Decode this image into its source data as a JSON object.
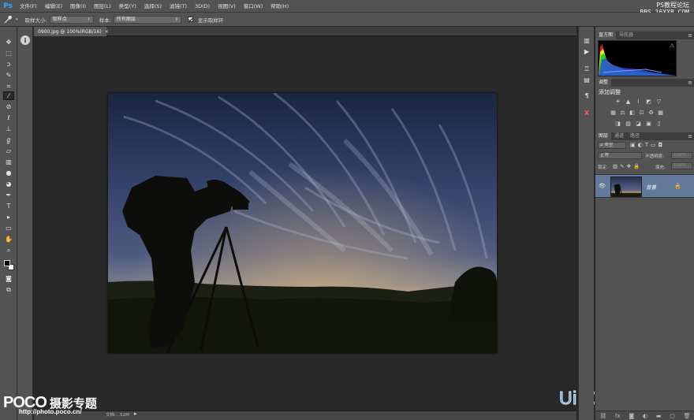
{
  "menubar": {
    "logo": "Ps",
    "items": [
      "文件(F)",
      "编辑(E)",
      "图像(I)",
      "图层(L)",
      "类型(Y)",
      "选择(S)",
      "滤镜(T)",
      "3D(D)",
      "视图(V)",
      "窗口(W)",
      "帮助(H)"
    ]
  },
  "watermark_top": {
    "line1": "PS教程论坛",
    "line2": "BBS.16XX8.COM"
  },
  "options": {
    "tool_icon": "eyedropper-icon",
    "sample_size_label": "取样大小:",
    "sample_size_value": "取样点",
    "sample_label": "样本:",
    "sample_value": "所有图层",
    "show_ring_label": "显示取样环",
    "show_ring_checked": true
  },
  "document": {
    "tab_title": "0900.jpg @ 100%(RGB/16)",
    "close": "×"
  },
  "status": {
    "size_text": "文档:...52M",
    "arrow": "▸"
  },
  "watermarks": {
    "poco_brand": "POCO",
    "poco_title": "摄影专题",
    "poco_url": "http://photo.poco.cn/",
    "uibq": "UiBQ.CoM"
  },
  "panels": {
    "histogram_tabs": [
      "直方图",
      "导航器"
    ],
    "histogram_warning": "⚠",
    "adjustments_tab": "调整",
    "adjustments_title": "添加调整",
    "layers_tabs": [
      "图层",
      "通道",
      "路径"
    ],
    "filter_kind": "ρ 类型",
    "blend_mode": "正常",
    "opacity_label": "不透明度:",
    "opacity_value": "100%",
    "lock_label": "锁定:",
    "fill_label": "填充:",
    "fill_value": "100%",
    "layer_name": "背景",
    "menu_glyph": "≡"
  },
  "colors": {
    "accent_blue": "#31a8ff",
    "layer_selected": "#63799c",
    "uibq_blue": "#2f90dc"
  }
}
